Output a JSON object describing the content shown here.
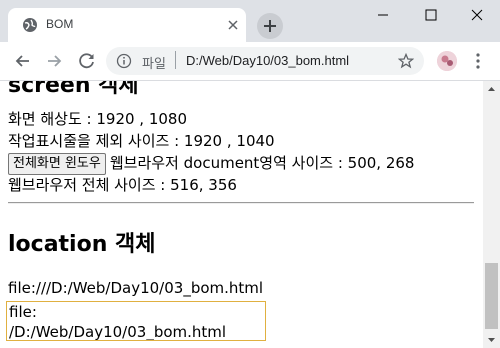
{
  "tab": {
    "title": "BOM",
    "favicon": "globe-icon"
  },
  "toolbar": {
    "url_scheme_label": "파일",
    "url": "D:/Web/Day10/03_bom.html"
  },
  "content": {
    "cut_heading": "screen 객체",
    "screen_resolution": "화면 해상도 : 1920 , 1080",
    "avail_size": "작업표시줄을 제외 사이즈 : 1920 , 1040",
    "fullscreen_button": "전체화면 윈도우",
    "document_size": "웹브라우저 document영역 사이즈 : 500, 268",
    "browser_size": "웹브라우저 전체 사이즈 : 516, 356",
    "location_heading": "location 객체",
    "location_href": "file:///D:/Web/Day10/03_bom.html",
    "location_protocol": "file:",
    "location_pathname": "/D:/Web/Day10/03_bom.html"
  },
  "colors": {
    "tabstrip": "#dee1e6",
    "omnibox": "#f1f3f4",
    "path_box_border": "#e0b040"
  }
}
